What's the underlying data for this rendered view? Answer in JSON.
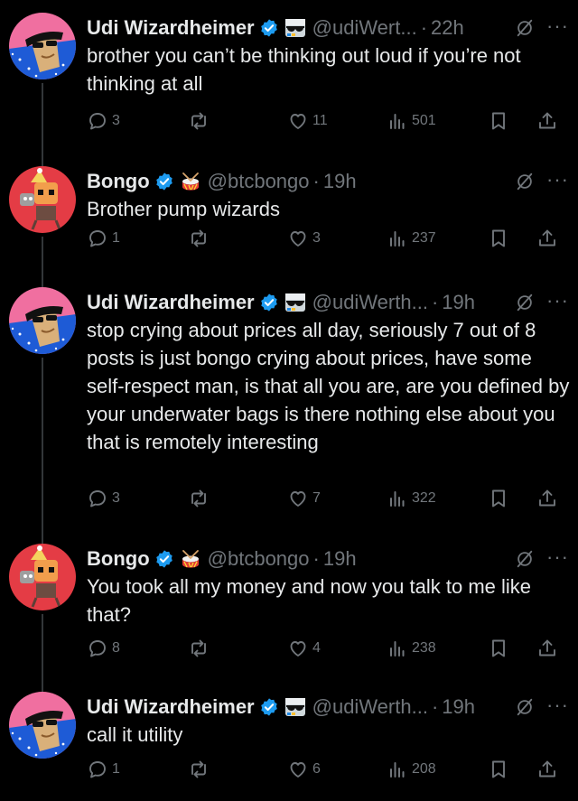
{
  "tweets": [
    {
      "author": "Udi Wizardheimer",
      "handle": "@udiWert...",
      "time": "22h",
      "text": "brother you can’t be thinking out loud if you’re not thinking at all",
      "replies": "3",
      "reposts": "",
      "likes": "11",
      "views": "501"
    },
    {
      "author": "Bongo",
      "handle": "@btcbongo",
      "time": "19h",
      "text": "Brother pump wizards",
      "replies": "1",
      "reposts": "",
      "likes": "3",
      "views": "237"
    },
    {
      "author": "Udi Wizardheimer",
      "handle": "@udiWerth...",
      "time": "19h",
      "text": "stop crying about prices all day, seriously 7 out of 8 posts is just bongo crying about prices, have some self-respect man, is that all you are, are you defined by your underwater bags is there nothing else about you that is remotely interesting",
      "replies": "3",
      "reposts": "",
      "likes": "7",
      "views": "322"
    },
    {
      "author": "Bongo",
      "handle": "@btcbongo",
      "time": "19h",
      "text": "You took all my money and now you talk to me like that?",
      "replies": "8",
      "reposts": "",
      "likes": "4",
      "views": "238"
    },
    {
      "author": "Udi Wizardheimer",
      "handle": "@udiWerth...",
      "time": "19h",
      "text": "call it utility",
      "replies": "1",
      "reposts": "",
      "likes": "6",
      "views": "208"
    }
  ],
  "separator": "·",
  "more_glyph": "···",
  "colors": {
    "background": "#000000",
    "text": "#e7e9ea",
    "muted": "#71767b",
    "verified": "#1d9bf0",
    "thread_line": "#333639"
  },
  "icons": [
    "verified-badge-icon",
    "grok-icon",
    "more-icon",
    "reply-icon",
    "repost-icon",
    "like-icon",
    "views-icon",
    "bookmark-icon",
    "share-icon",
    "drum-emoji-icon",
    "sunglasses-flag-emoji-icon"
  ]
}
